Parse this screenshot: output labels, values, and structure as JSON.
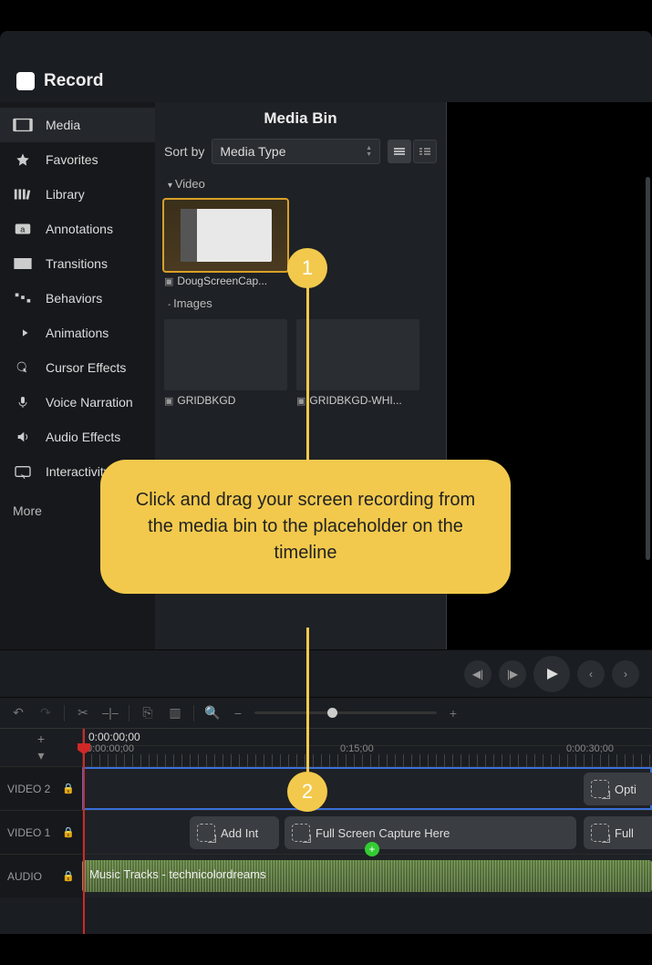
{
  "titlebar": {
    "record_label": "Record"
  },
  "sidebar": {
    "items": [
      {
        "id": "media",
        "label": "Media",
        "icon": "media"
      },
      {
        "id": "favorites",
        "label": "Favorites",
        "icon": "star"
      },
      {
        "id": "library",
        "label": "Library",
        "icon": "books"
      },
      {
        "id": "annotations",
        "label": "Annotations",
        "icon": "annotation"
      },
      {
        "id": "transitions",
        "label": "Transitions",
        "icon": "transition"
      },
      {
        "id": "behaviors",
        "label": "Behaviors",
        "icon": "behaviors"
      },
      {
        "id": "animations",
        "label": "Animations",
        "icon": "arrow"
      },
      {
        "id": "cursor",
        "label": "Cursor Effects",
        "icon": "cursor"
      },
      {
        "id": "voice",
        "label": "Voice Narration",
        "icon": "mic"
      },
      {
        "id": "audio",
        "label": "Audio Effects",
        "icon": "speaker"
      },
      {
        "id": "interactivity",
        "label": "Interactivity",
        "icon": "interact"
      }
    ],
    "more_label": "More"
  },
  "mediabin": {
    "title": "Media Bin",
    "sort_label": "Sort by",
    "sort_value": "Media Type",
    "section_video": "Video",
    "section_images": "Images",
    "clip1": "DougScreenCap...",
    "image1": "GRIDBKGD",
    "image2": "GRIDBKGD-WHI..."
  },
  "timeline": {
    "timecode_main": "0:00:00;00",
    "tc0": "0:00:00;00",
    "tc15": "0:15;00",
    "tc30": "0:00:30;00",
    "track_v2": "VIDEO 2",
    "track_v1": "VIDEO 1",
    "track_a": "AUDIO",
    "clip_opt": "Opti",
    "clip_addint": "Add Int",
    "clip_fullscreen": "Full Screen Capture Here",
    "clip_full": "Full",
    "audio_clip": "Music Tracks - technicolordreams"
  },
  "tooltip": {
    "text": "Click and drag your screen recording from the media bin to the placeholder on the timeline",
    "step1": "1",
    "step2": "2"
  }
}
